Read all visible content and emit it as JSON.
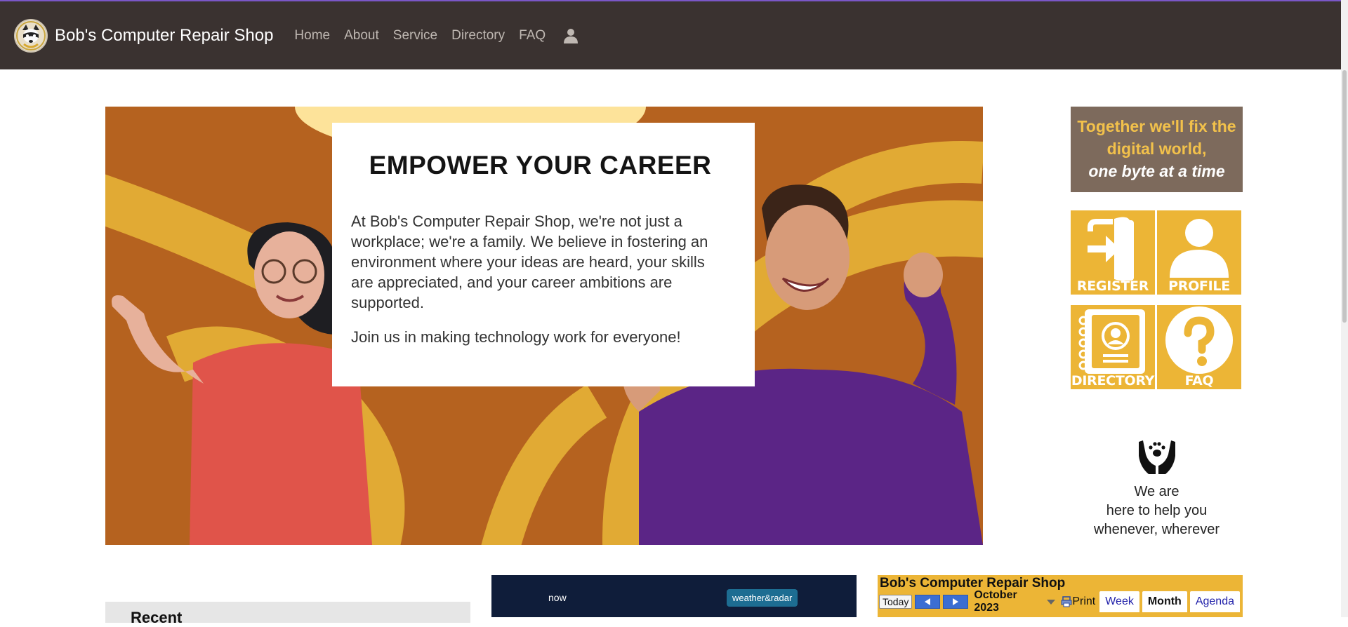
{
  "nav": {
    "brand": "Bob's Computer Repair Shop",
    "links": [
      "Home",
      "About",
      "Service",
      "Directory",
      "FAQ"
    ],
    "user_icon": "user-icon"
  },
  "hero": {
    "title": "EMPOWER YOUR CAREER",
    "paragraph1": "At Bob's Computer Repair Shop, we're not just a workplace; we're a family. We believe in fostering an environment where your ideas are heard, your skills are appreciated, and your career ambitions are supported.",
    "paragraph2": "Join us in making technology work for everyone!"
  },
  "slogan": {
    "line1": "Together we'll fix the digital world,",
    "line2": "one byte at a time"
  },
  "tiles": [
    {
      "label": "REGISTER",
      "icon": "sign-in-icon"
    },
    {
      "label": "PROFILE",
      "icon": "person-icon"
    },
    {
      "label": "DIRECTORY",
      "icon": "contact-book-icon"
    },
    {
      "label": "FAQ",
      "icon": "question-icon"
    }
  ],
  "help": {
    "icon": "hands-paw-icon",
    "text_line1": "We are",
    "text_line2": "here to help you",
    "text_line3": "whenever, wherever"
  },
  "recent": {
    "title": "Recent"
  },
  "weather": {
    "now": "now",
    "brand": "weather&radar"
  },
  "calendar": {
    "title": "Bob's Computer Repair Shop",
    "today": "Today",
    "month": "October 2023",
    "print": "Print",
    "tabs": [
      "Week",
      "Month",
      "Agenda"
    ],
    "active_tab": "Month"
  },
  "colors": {
    "navbar": "#3a3230",
    "accent": "#ecb536",
    "hero_bg": "#b5621f",
    "slogan_bg": "#7d6a5c"
  }
}
